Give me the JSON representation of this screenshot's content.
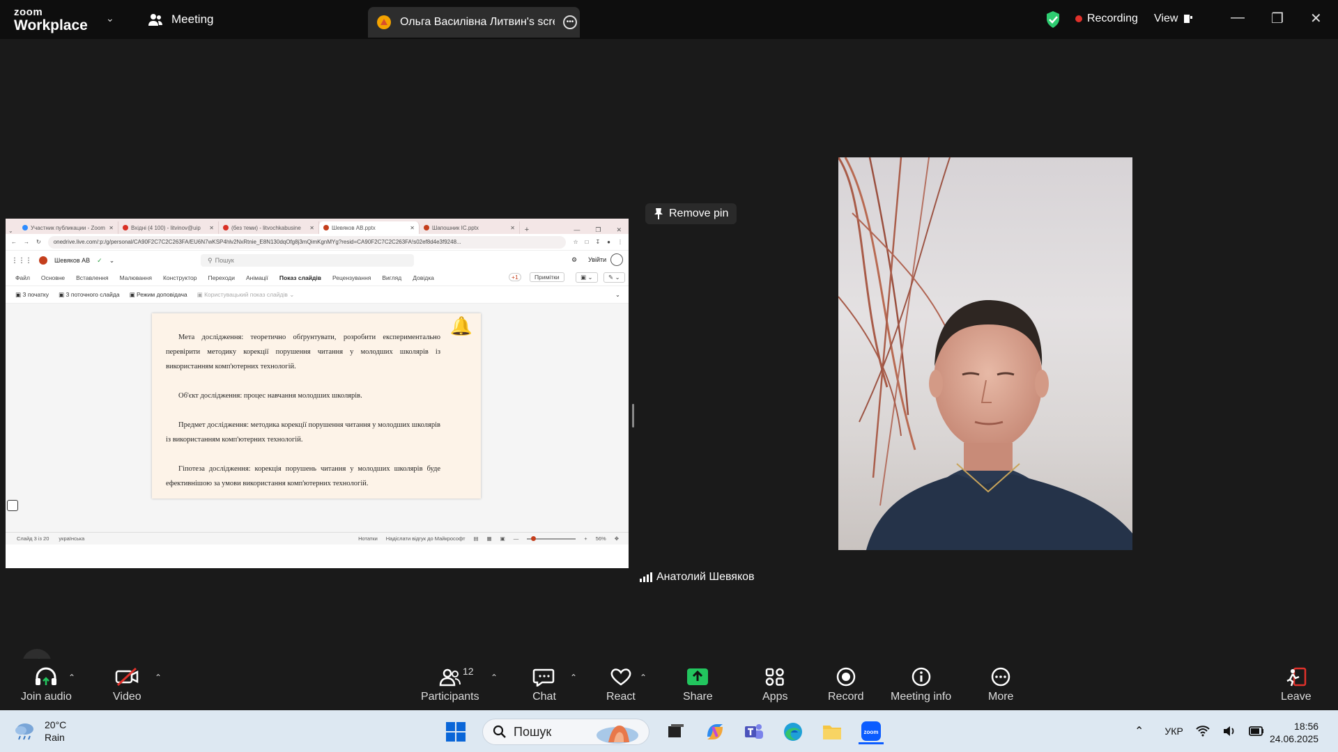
{
  "topbar": {
    "logo_top": "zoom",
    "logo_bottom": "Workplace",
    "meeting_tab": "Meeting",
    "share_tab_title": "Ольга Василівна Литвин's screen",
    "recording": "Recording",
    "view": "View"
  },
  "colors": {
    "accent": "#0b5cff",
    "record": "#e0312b",
    "share": "#22c55e",
    "shield": "#2ecc71",
    "leave": "#e0312b"
  },
  "shared_screen": {
    "browser_tabs": [
      {
        "label": "Участник публикации - Zoom",
        "color": "#2d8cff"
      },
      {
        "label": "Вхідні (4 100) - litvinov@uip",
        "color": "#d93025"
      },
      {
        "label": "(без теми) - litvochkabusine",
        "color": "#d93025"
      },
      {
        "label": "Шевяков АВ.pptx",
        "color": "#c43e1c"
      },
      {
        "label": "Шапошник ІС.pptx",
        "color": "#c43e1c"
      }
    ],
    "url": "onedrive.live.com/:p:/g/personal/CA90F2C7C2C263FA/EU6N7wKSP4hlv2NxRtnie_E8N130dqOfg8j3mQimKgnMYg?resid=CA90F2C7C2C263FA!s02ef8d4e3f9248...",
    "doc_name": "Шевяков АВ",
    "search_placeholder": "Пошук",
    "sign_in": "Увійти",
    "ribbon_tabs": [
      "Файл",
      "Основне",
      "Вставлення",
      "Малювання",
      "Конструктор",
      "Переходи",
      "Анімації",
      "Показ слайдів",
      "Рецензування",
      "Вигляд",
      "Довідка"
    ],
    "ribbon_active": "Показ слайдів",
    "notes_btn": "Примітки",
    "plus_one": "+1",
    "cmds": [
      "З початку",
      "З поточного слайда",
      "Режим доповідача"
    ],
    "cmd_disabled": "Користувацький показ слайдів",
    "slide_paragraphs": [
      "Мета дослідження: теоретично обґрунтувати, розробити експериментально перевірити методику корекції порушення читання у молодших школярів із використанням комп'ютерних технологій.",
      "Об'єкт дослідження: процес навчання молодших школярів.",
      "Предмет дослідження: методика корекції порушення читання у молодших школярів із використанням комп'ютерних технологій.",
      "Гіпотеза дослідження: корекція порушень читання у молодших школярів буде ефективнішою за умови використання комп'ютерних технологій."
    ],
    "status_slide": "Слайд 3 із 20",
    "status_lang": "українська",
    "status_notes": "Нотатки",
    "status_feedback": "Надіслати відгук до Майкрософт",
    "status_zoom": "56%"
  },
  "remove_pin": "Remove pin",
  "participant_name": "Анатолий Шевяков",
  "toolbar": {
    "join_audio": "Join audio",
    "video": "Video",
    "participants": "Participants",
    "participants_count": "12",
    "chat": "Chat",
    "react": "React",
    "share": "Share",
    "apps": "Apps",
    "record": "Record",
    "meeting_info": "Meeting info",
    "more": "More",
    "leave": "Leave"
  },
  "taskbar": {
    "temp": "20°C",
    "weather": "Rain",
    "search": "Пошук",
    "lang": "УКР",
    "time": "18:56",
    "date": "24.06.2025"
  }
}
